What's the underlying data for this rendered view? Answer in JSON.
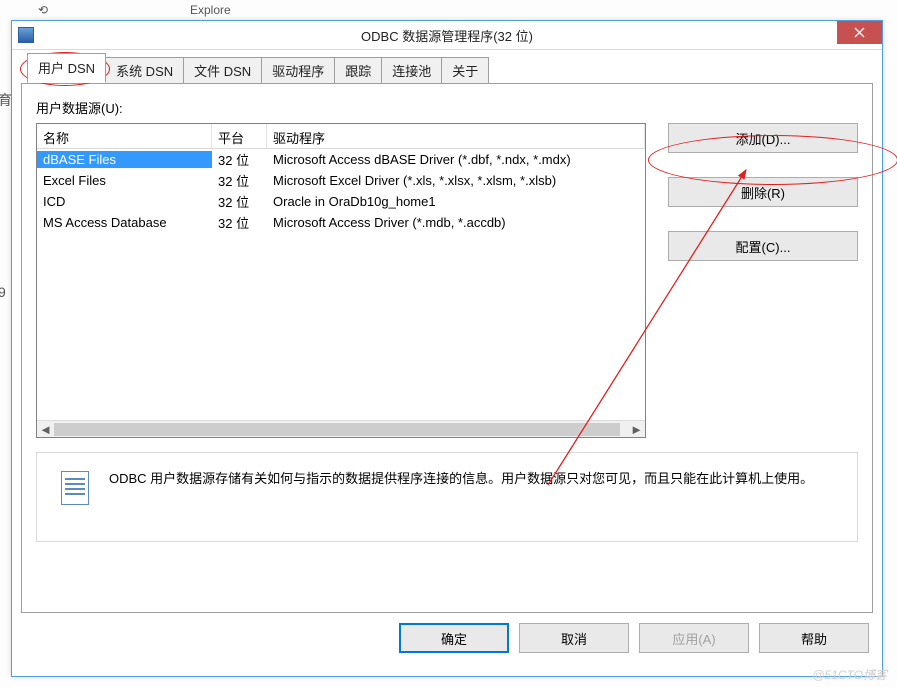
{
  "window": {
    "title": "ODBC 数据源管理程序(32 位)"
  },
  "tabs": [
    {
      "label": "用户 DSN",
      "active": true
    },
    {
      "label": "系统 DSN",
      "active": false
    },
    {
      "label": "文件 DSN",
      "active": false
    },
    {
      "label": "驱动程序",
      "active": false
    },
    {
      "label": "跟踪",
      "active": false
    },
    {
      "label": "连接池",
      "active": false
    },
    {
      "label": "关于",
      "active": false
    }
  ],
  "panel": {
    "userDataSourcesLabel": "用户数据源(U):",
    "columns": {
      "name": "名称",
      "platform": "平台",
      "driver": "驱动程序"
    },
    "rows": [
      {
        "name": "dBASE Files",
        "platform": "32 位",
        "driver": "Microsoft Access dBASE Driver (*.dbf, *.ndx, *.mdx)",
        "selected": true
      },
      {
        "name": "Excel Files",
        "platform": "32 位",
        "driver": "Microsoft Excel Driver (*.xls, *.xlsx, *.xlsm, *.xlsb)",
        "selected": false
      },
      {
        "name": "ICD",
        "platform": "32 位",
        "driver": "Oracle in OraDb10g_home1",
        "selected": false
      },
      {
        "name": "MS Access Database",
        "platform": "32 位",
        "driver": "Microsoft Access Driver (*.mdb, *.accdb)",
        "selected": false
      }
    ],
    "buttons": {
      "add": "添加(D)...",
      "remove": "删除(R)",
      "configure": "配置(C)..."
    },
    "infoText": "ODBC 用户数据源存储有关如何与指示的数据提供程序连接的信息。用户数据源只对您可见，而且只能在此计算机上使用。"
  },
  "dialogButtons": {
    "ok": "确定",
    "cancel": "取消",
    "apply": "应用(A)",
    "help": "帮助"
  },
  "outer": {
    "explore": "Explore",
    "watermark": "@51CTO博客"
  }
}
